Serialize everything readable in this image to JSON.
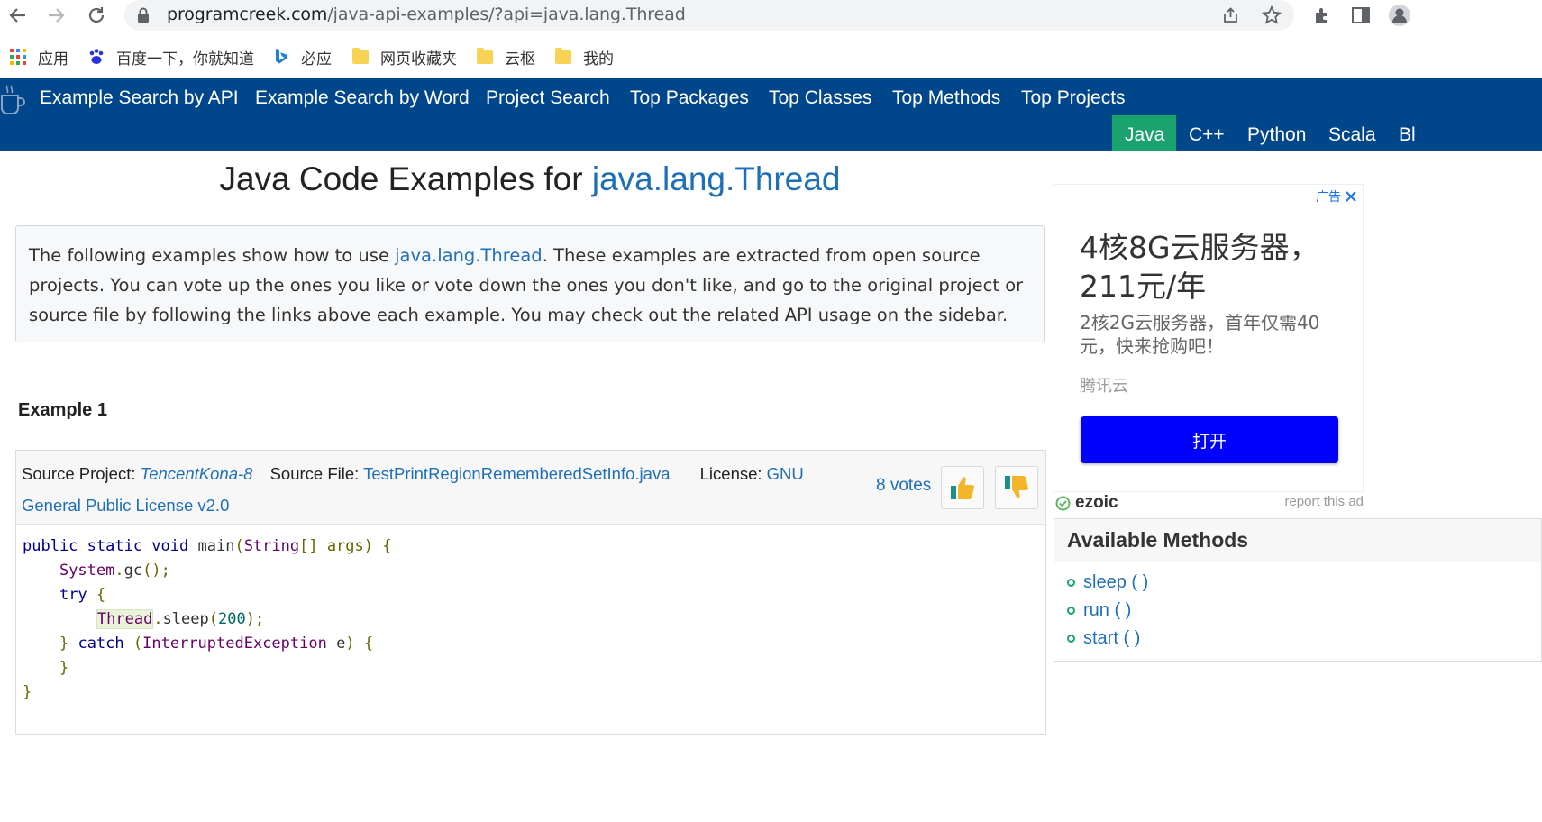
{
  "browser": {
    "url_host": "programcreek.com",
    "url_path": "/java-api-examples/?api=java.lang.Thread",
    "bookmarks": [
      "应用",
      "百度一下，你就知道",
      "必应",
      "网页收藏夹",
      "云枢",
      "我的"
    ]
  },
  "site_nav": {
    "items": [
      "Example Search by API",
      "Example Search by Word",
      "Project Search",
      "Top Packages",
      "Top Classes",
      "Top Methods",
      "Top Projects"
    ],
    "languages": [
      "Java",
      "C++",
      "Python",
      "Scala",
      "Bl"
    ],
    "active_language": "Java"
  },
  "page": {
    "title_prefix": "Java Code Examples for ",
    "title_api": "java.lang.Thread",
    "intro_before": "The following examples show how to use ",
    "intro_link": "java.lang.Thread",
    "intro_after": ". These examples are extracted from open source projects. You can vote up the ones you like or vote down the ones you don't like, and go to the original project or source file by following the links above each example. You may check out the related API usage on the sidebar."
  },
  "example": {
    "heading": "Example 1",
    "source_project_label": "Source Project:",
    "source_project": "TencentKona-8",
    "source_file_label": "Source File:",
    "source_file": "TestPrintRegionRememberedSetInfo.java",
    "license_label": "License:",
    "license": "GNU General Public License v2.0",
    "votes": "8 votes",
    "code": {
      "l1_kw": "public static void",
      "l1_name": "main",
      "l1_type": "String",
      "l1_rest": "[] args)",
      "l2_type": "System",
      "l2_rest": "gc",
      "l3_kw": "try",
      "l4_type": "Thread",
      "l4_method": "sleep",
      "l4_num": "200",
      "l5_kw": "catch",
      "l5_type": "InterruptedException",
      "l5_var": "e"
    }
  },
  "ad": {
    "label": "广告",
    "headline": "4核8G云服务器，211元/年",
    "subline": "2核2G云服务器，首年仅需40元，快来抢购吧！",
    "brand": "腾讯云",
    "button": "打开",
    "network": "ezoic",
    "report": "report this ad"
  },
  "sidebar": {
    "title": "Available Methods",
    "methods": [
      "sleep ( )",
      "run ( )",
      "start ( )"
    ]
  }
}
